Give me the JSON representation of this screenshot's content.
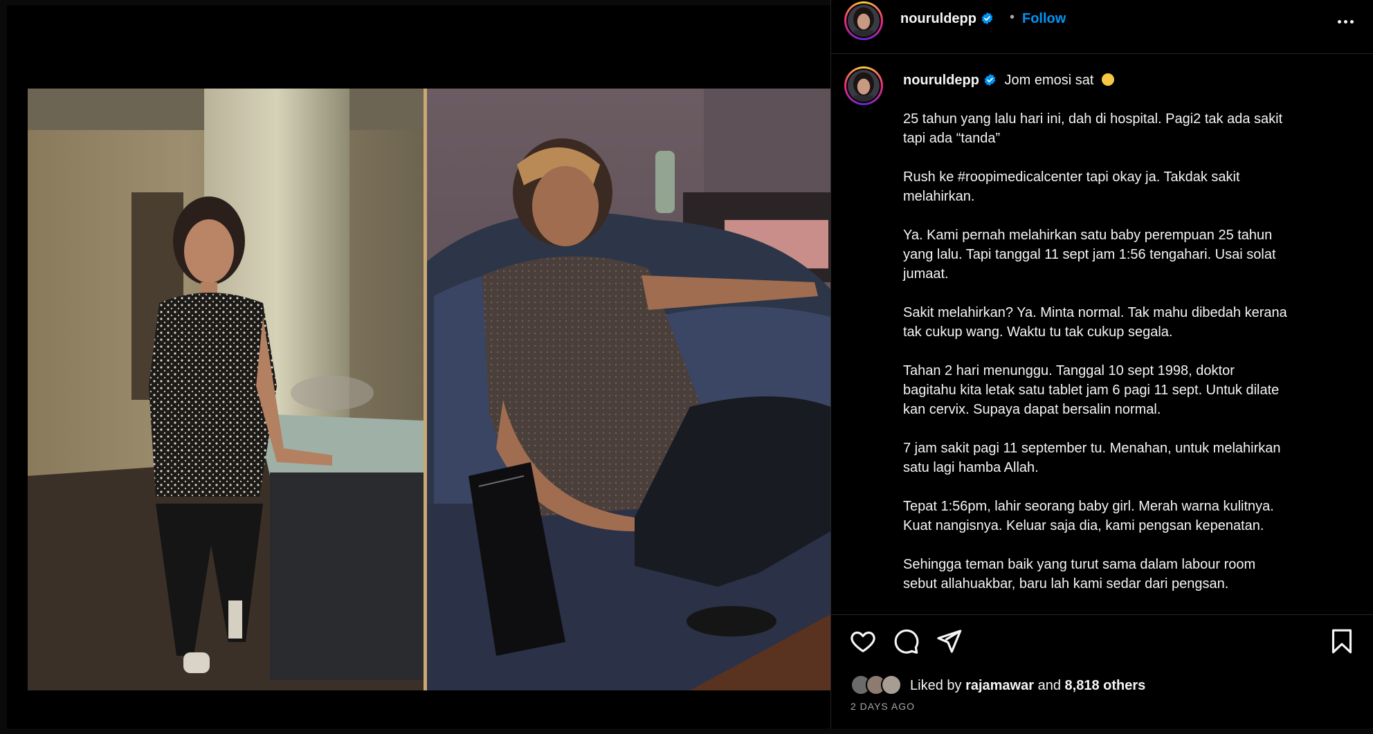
{
  "post": {
    "username": "nouruldepp",
    "follow_label": "Follow",
    "separator": "•",
    "caption_title": "Jom emosi sat",
    "caption_paragraphs": [
      "25 tahun yang lalu hari ini, dah di hospital. Pagi2 tak ada sakit\ntapi ada “tanda”",
      "Rush ke #roopimedicalcenter tapi okay ja. Takdak sakit\nmelahirkan.",
      "Ya. Kami pernah melahirkan satu baby perempuan 25 tahun\nyang lalu. Tapi tanggal 11 sept jam 1:56 tengahari. Usai solat\njumaat.",
      "Sakit melahirkan? Ya. Minta normal. Tak mahu dibedah kerana\ntak cukup wang. Waktu tu tak cukup segala.",
      "Tahan 2 hari menunggu. Tanggal 10 sept 1998, doktor\nbagitahu kita letak satu tablet jam 6 pagi 11 sept. Untuk dilate\nkan cervix. Supaya dapat bersalin normal.",
      "7 jam sakit pagi 11 september tu. Menahan, untuk melahirkan\nsatu lagi hamba Allah.",
      "Tepat 1:56pm, lahir seorang baby girl. Merah warna kulitnya.\nKuat nangisnya. Keluar saja dia, kami pengsan kepenatan.",
      "Sehingga teman baik yang turut sama dalam labour room\nsebut allahuakbar, baru lah kami sedar dari pengsan."
    ]
  },
  "engagement": {
    "liked_by_prefix": "Liked by",
    "liked_by_user": "rajamawar",
    "and_label": "and",
    "others_count": "8,818 others",
    "timestamp": "2 DAYS AGO"
  },
  "icons": {
    "verified": "verified-badge-icon",
    "like": "heart-icon",
    "comment": "comment-icon",
    "share": "send-icon",
    "save": "bookmark-icon",
    "more": "more-options-icon"
  },
  "colors": {
    "accent": "#0095f6",
    "background": "#000000",
    "text": "#f5f5f5",
    "muted": "#a8a8a8"
  }
}
